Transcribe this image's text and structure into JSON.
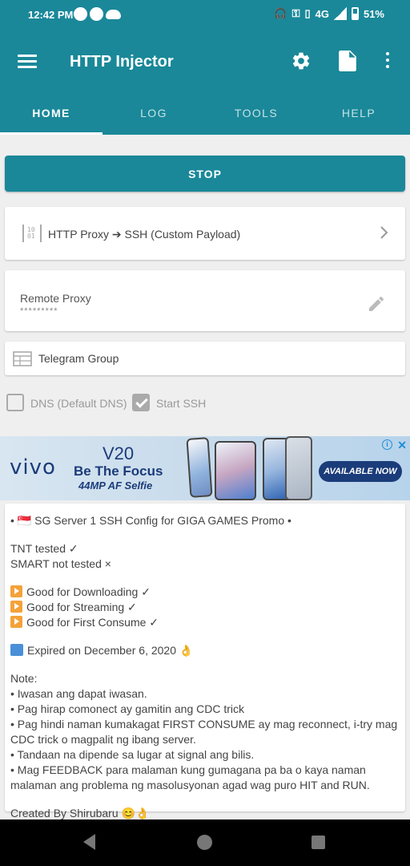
{
  "status_bar": {
    "time": "12:42 PM",
    "network": "4G",
    "network_small": "4G",
    "battery": "51%"
  },
  "app": {
    "title": "HTTP Injector",
    "icons": [
      "menu-icon",
      "settings-gear-icon",
      "document-icon",
      "more-vert-icon"
    ]
  },
  "tabs": [
    {
      "label": "HOME",
      "active": true
    },
    {
      "label": "LOG",
      "active": false
    },
    {
      "label": "TOOLS",
      "active": false
    },
    {
      "label": "HELP",
      "active": false
    }
  ],
  "main": {
    "stop_label": "STOP",
    "proxy_mode": "HTTP Proxy ➔ SSH (Custom Payload)",
    "remote_proxy": {
      "title": "Remote Proxy",
      "value": "*********"
    },
    "telegram": "Telegram Group",
    "checkboxes": [
      {
        "label": "DNS (Default DNS)",
        "checked": false
      },
      {
        "label": "Start SSH",
        "checked": true
      }
    ]
  },
  "ad": {
    "brand": "vivo",
    "model": "V20",
    "tagline": "Be The Focus",
    "subline": "44MP AF Selfie",
    "cta": "AVAILABLE NOW",
    "info": "i",
    "close": "✕"
  },
  "config": {
    "header": "• 🇸🇬 SG Server 1 SSH Config for GIGA GAMES Promo •",
    "tested": [
      "TNT tested ✓",
      "SMART not tested ×"
    ],
    "features": [
      "Good for Downloading ✓",
      "Good for Streaming ✓",
      "Good for First Consume ✓"
    ],
    "expiry": "Expired on December 6, 2020 👌",
    "note_title": "Note:",
    "notes": [
      "• Iwasan ang dapat iwasan.",
      "• Pag hirap comonect ay gamitin ang CDC trick",
      "• Pag hindi naman kumakagat FIRST CONSUME ay mag reconnect, i-try mag CDC trick o magpalit ng ibang server.",
      "• Tandaan na dipende sa lugar at signal ang bilis.",
      "• Mag FEEDBACK para malaman kung gumagana pa ba o kaya naman malaman ang problema ng masolusyonan agad wag puro HIT and RUN."
    ],
    "footer": "Created By Shirubaru 😊👌"
  },
  "colors": {
    "primary": "#1a8899",
    "background": "#efefef",
    "ad_blue": "#1b3c7a"
  }
}
